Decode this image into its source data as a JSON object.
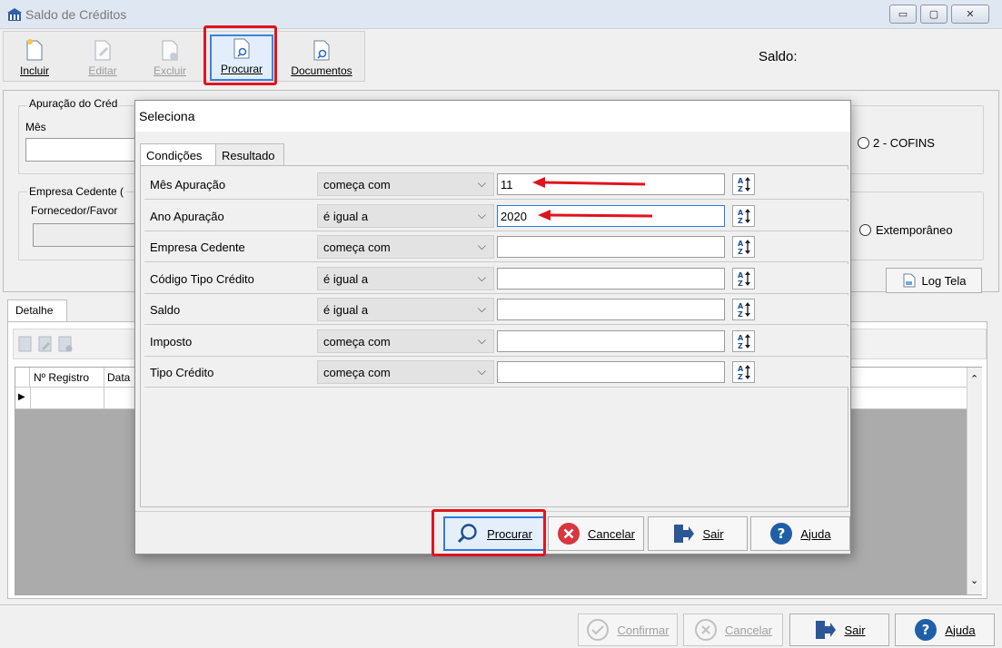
{
  "window": {
    "title": "Saldo de Créditos",
    "controls": [
      "▭",
      "▢",
      "✕"
    ]
  },
  "toolbar": {
    "incluir": "Incluir",
    "editar": "Editar",
    "excluir": "Excluir",
    "procurar": "Procurar",
    "documentos": "Documentos"
  },
  "saldo_label": "Saldo:",
  "form": {
    "apuracao_title": "Apuração do Créd",
    "mes_label": "Mês",
    "cofins_label": "2 - COFINS",
    "empresa_title": "Empresa Cedente (",
    "fornecedor_label": "Fornecedor/Favor",
    "extemporaneo_label": "Extemporâneo",
    "log_tela": "Log Tela"
  },
  "detail": {
    "tab": "Detalhe",
    "columns": [
      "Nº Registro",
      "Data"
    ]
  },
  "bottom": {
    "confirmar": "Confirmar",
    "cancelar": "Cancelar",
    "sair": "Sair",
    "ajuda": "Ajuda"
  },
  "dialog": {
    "title": "Seleciona",
    "tabs": [
      "Condições",
      "Resultado"
    ],
    "rows": [
      {
        "field": "Mês Apuração",
        "operator": "começa com",
        "value": "11"
      },
      {
        "field": "Ano Apuração",
        "operator": "é igual a",
        "value": "2020"
      },
      {
        "field": "Empresa Cedente",
        "operator": "começa com",
        "value": ""
      },
      {
        "field": "Código Tipo Crédito",
        "operator": "é igual a",
        "value": ""
      },
      {
        "field": "Saldo",
        "operator": "é igual a",
        "value": ""
      },
      {
        "field": "Imposto",
        "operator": "começa com",
        "value": ""
      },
      {
        "field": "Tipo Crédito",
        "operator": "começa com",
        "value": ""
      }
    ],
    "buttons": {
      "procurar": "Procurar",
      "cancelar": "Cancelar",
      "sair": "Sair",
      "ajuda": "Ajuda"
    }
  },
  "colors": {
    "highlight_red": "#e0141e",
    "accent_blue": "#2c7be5",
    "help_blue": "#1e5fa8",
    "cancel_red": "#d9363e"
  }
}
